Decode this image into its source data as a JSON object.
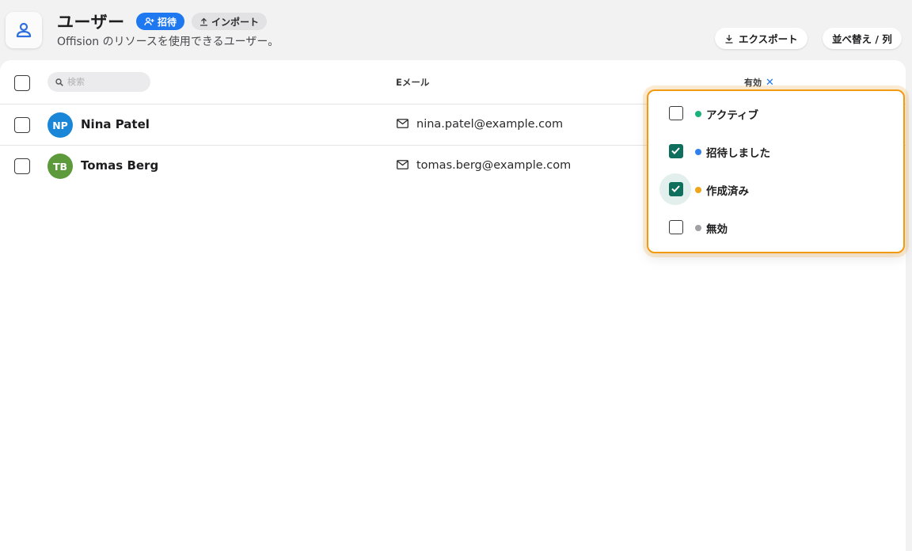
{
  "header": {
    "title": "ユーザー",
    "invite_label": "招待",
    "import_label": "インポート",
    "subtitle": "Offision のリソースを使用できるユーザー。",
    "export_label": "エクスポート",
    "sort_label": "並べ替え / 列"
  },
  "table": {
    "search_placeholder": "検索",
    "columns": {
      "email": "Eメール",
      "active": "有効"
    },
    "rows": [
      {
        "initials": "NP",
        "name": "Nina Patel",
        "email": "nina.patel@example.com",
        "avatar_color": "#1a86d8"
      },
      {
        "initials": "TB",
        "name": "Tomas Berg",
        "email": "tomas.berg@example.com",
        "avatar_color": "#5d9a3c"
      }
    ]
  },
  "filter_menu": {
    "options": [
      {
        "label": "アクティブ",
        "checked": false,
        "dot_color": "#18b27a"
      },
      {
        "label": "招待しました",
        "checked": true,
        "dot_color": "#2f80ed"
      },
      {
        "label": "作成済み",
        "checked": true,
        "dot_color": "#f0a41c",
        "focused": true
      },
      {
        "label": "無効",
        "checked": false,
        "dot_color": "#a0a0a5"
      }
    ]
  },
  "colors": {
    "accent": "#1e78f0",
    "checkbox_checked": "#0f6e5c",
    "menu_border": "#f19a12"
  },
  "icons": {
    "app": "user-icon",
    "invite": "add-user-icon",
    "import": "upload-icon",
    "export": "download-icon",
    "search": "search-icon",
    "email": "mail-icon",
    "clear_filter": "close-icon"
  }
}
